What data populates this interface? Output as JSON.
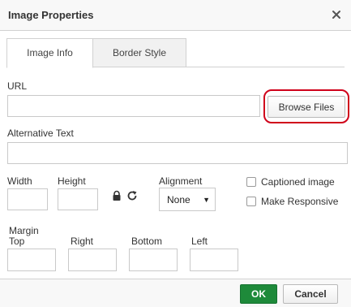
{
  "dialog": {
    "title": "Image Properties",
    "close_icon": "close-icon"
  },
  "tabs": [
    {
      "label": "Image Info",
      "active": true
    },
    {
      "label": "Border Style",
      "active": false
    }
  ],
  "url": {
    "label": "URL",
    "value": "",
    "browse_label": "Browse Files"
  },
  "alt_text": {
    "label": "Alternative Text",
    "value": ""
  },
  "width": {
    "label": "Width",
    "value": ""
  },
  "height": {
    "label": "Height",
    "value": ""
  },
  "icons": {
    "lock": "lock-icon",
    "reset": "reset-size-icon"
  },
  "alignment": {
    "label": "Alignment",
    "selected": "None",
    "arrow": "▼"
  },
  "options": {
    "captioned": {
      "label": "Captioned image",
      "checked": false
    },
    "responsive": {
      "label": "Make Responsive",
      "checked": false
    }
  },
  "margin": {
    "label": "Margin",
    "top_label": "Top",
    "right_label": "Right",
    "bottom_label": "Bottom",
    "left_label": "Left",
    "top": "",
    "right": "",
    "bottom": "",
    "left": ""
  },
  "footer": {
    "ok_label": "OK",
    "cancel_label": "Cancel"
  },
  "colors": {
    "ok_button": "#1e8a3a",
    "highlight": "#d0021b"
  }
}
